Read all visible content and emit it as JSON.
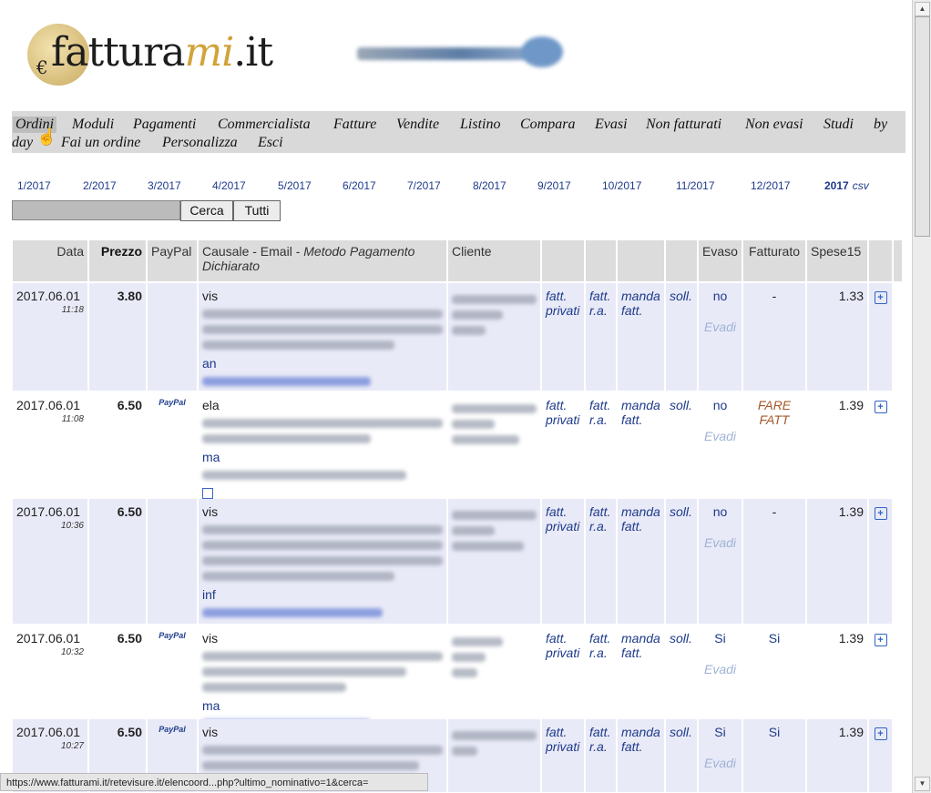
{
  "logo": {
    "prefix": "fattura",
    "accent": "mi",
    "suffix": ".it",
    "euro": "€",
    "partner_alt": "retevisure"
  },
  "menu": {
    "items": [
      "Ordini",
      "Moduli",
      "Pagamenti",
      "Commercialista",
      "Fatture",
      "Vendite",
      "Listino",
      "Compara",
      "Evasi",
      "Non fatturati",
      "Non evasi",
      "Studi",
      "by",
      "day",
      "Fai un ordine",
      "Personalizza",
      "Esci"
    ],
    "active": "Ordini"
  },
  "months": [
    "1/2017",
    "2/2017",
    "3/2017",
    "4/2017",
    "5/2017",
    "6/2017",
    "7/2017",
    "8/2017",
    "9/2017",
    "10/2017",
    "11/2017",
    "12/2017"
  ],
  "year": {
    "label": "2017",
    "csv": "csv"
  },
  "search": {
    "value": "",
    "cerca": "Cerca",
    "tutti": "Tutti"
  },
  "table": {
    "headers": {
      "data": "Data",
      "prezzo": "Prezzo",
      "paypal": "PayPal",
      "causale": "Causale - Email - ",
      "causale_italic": "Metodo Pagamento Dichiarato",
      "cliente": "Cliente",
      "evaso": "Evaso",
      "fatturato": "Fatturato",
      "spese": "Spese15"
    },
    "rows": [
      {
        "date": "2017.06.01",
        "time": "11:18",
        "price": "3.80",
        "paypal": "",
        "causale_start": "vis",
        "email_start": "an",
        "fatt_privati": "fatt. privati",
        "fatt_ra": "fatt. r.a.",
        "manda": "manda fatt.",
        "soll": "soll.",
        "evaso": "no",
        "evadi": "Evadi",
        "fatturato": "-",
        "spese": "1.33"
      },
      {
        "date": "2017.06.01",
        "time": "11:08",
        "price": "6.50",
        "paypal": "PayPal",
        "causale_start": "ela",
        "email_start": "ma",
        "fatt_privati": "fatt. privati",
        "fatt_ra": "fatt. r.a.",
        "manda": "manda fatt.",
        "soll": "soll.",
        "evaso": "no",
        "evadi": "Evadi",
        "fatturato": "FARE FATT",
        "spese": "1.39"
      },
      {
        "date": "2017.06.01",
        "time": "10:36",
        "price": "6.50",
        "paypal": "",
        "causale_start": "vis",
        "email_start": "inf",
        "fatt_privati": "fatt. privati",
        "fatt_ra": "fatt. r.a.",
        "manda": "manda fatt.",
        "soll": "soll.",
        "evaso": "no",
        "evadi": "Evadi",
        "fatturato": "-",
        "spese": "1.39"
      },
      {
        "date": "2017.06.01",
        "time": "10:32",
        "price": "6.50",
        "paypal": "PayPal",
        "causale_start": "vis",
        "email_start": "ma",
        "fatt_privati": "fatt. privati",
        "fatt_ra": "fatt. r.a.",
        "manda": "manda fatt.",
        "soll": "soll.",
        "evaso": "Si",
        "evadi": "Evadi",
        "fatturato": "Si",
        "spese": "1.39"
      },
      {
        "date": "2017.06.01",
        "time": "10:27",
        "price": "6.50",
        "paypal": "PayPal",
        "causale_start": "vis",
        "email_start": "",
        "fatt_privati": "fatt. privati",
        "fatt_ra": "fatt. r.a.",
        "manda": "manda fatt.",
        "soll": "soll.",
        "evaso": "Si",
        "evadi": "Evadi",
        "fatturato": "Si",
        "spese": "1.39"
      }
    ]
  },
  "status_bar": "https://www.fatturami.it/retevisure.it/elencoord...php?ultimo_nominativo=1&cerca="
}
